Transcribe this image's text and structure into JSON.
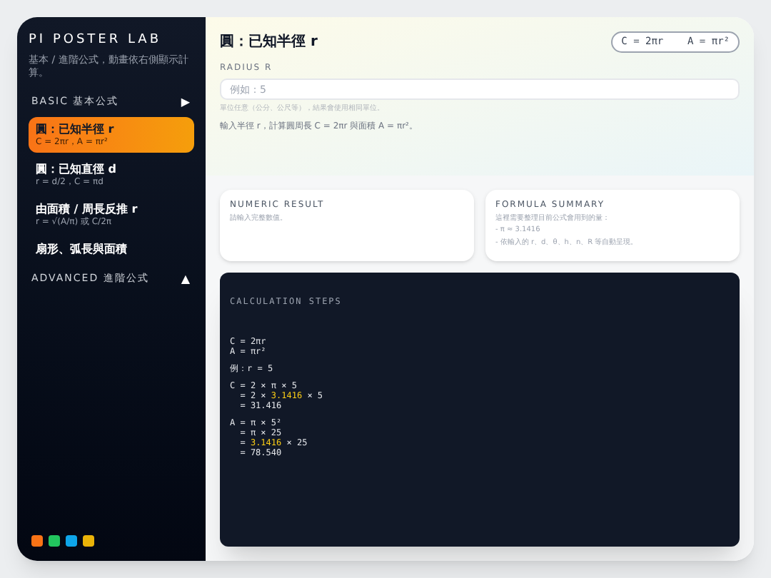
{
  "sidebar": {
    "title": "PI POSTER LAB",
    "subtitle": "基本 / 進階公式，動畫依右側顯示計算。",
    "sections": [
      {
        "label": "BASIC 基本公式",
        "toggle": "▶",
        "items": [
          {
            "title": "圓：已知半徑 r",
            "formula": "C = 2πr，A = πr²",
            "selected": true
          },
          {
            "title": "圓：已知直徑 d",
            "formula": "r = d/2，C = πd",
            "selected": false
          },
          {
            "title": "由面積 / 周長反推 r",
            "formula": "r = √(A/π) 或 C/2π",
            "selected": false
          },
          {
            "title": "扇形、弧長與面積",
            "selected": false
          }
        ]
      },
      {
        "label": "ADVANCED 進階公式",
        "toggle": "▲"
      }
    ],
    "swatches": [
      {
        "color": "#f97316"
      },
      {
        "color": "#22c55e"
      },
      {
        "color": "#0ea5e9"
      },
      {
        "color": "#eab308"
      }
    ]
  },
  "header": {
    "title": "圓：已知半徑 r",
    "badge": "C = 2πr    A = πr²"
  },
  "input": {
    "label": "RADIUS R",
    "placeholder": "例如：5",
    "hint": "單位任意（公分、公尺等），結果會使用相同單位。",
    "description": "輸入半徑 r，計算圓周長 C = 2πr 與面積 A = πr²。"
  },
  "numeric_result": {
    "title": "NUMERIC RESULT",
    "text": "請輸入完整數值。"
  },
  "formula_summary": {
    "title": "FORMULA SUMMARY",
    "lines": [
      "這裡需要整理目前公式會用到的量：",
      "- π ≈ 3.1416",
      "- 依輸入的 r、d、θ、h、n、R 等自動呈現。"
    ]
  },
  "steps": {
    "title": "CALCULATION STEPS",
    "blocks": [
      [
        [
          {
            "text": "C = 2πr",
            "highlight": false
          }
        ],
        [
          {
            "text": "A = πr²",
            "highlight": false
          }
        ]
      ],
      [
        [
          {
            "text": "例：r = 5",
            "highlight": false
          }
        ]
      ],
      [
        [
          {
            "text": "C = 2 × π × 5",
            "highlight": false
          }
        ],
        [
          {
            "text": "  = 2 × ",
            "highlight": false
          },
          {
            "text": "3.1416",
            "highlight": true
          },
          {
            "text": " × 5",
            "highlight": false
          }
        ],
        [
          {
            "text": "  = 31.416",
            "highlight": false
          }
        ]
      ],
      [
        [
          {
            "text": "A = π × 5²",
            "highlight": false
          }
        ],
        [
          {
            "text": "  = π × 25",
            "highlight": false
          }
        ],
        [
          {
            "text": "  = ",
            "highlight": false
          },
          {
            "text": "3.1416",
            "highlight": true
          },
          {
            "text": " × 25",
            "highlight": false
          }
        ],
        [
          {
            "text": "  = 78.540",
            "highlight": false
          }
        ]
      ]
    ]
  }
}
